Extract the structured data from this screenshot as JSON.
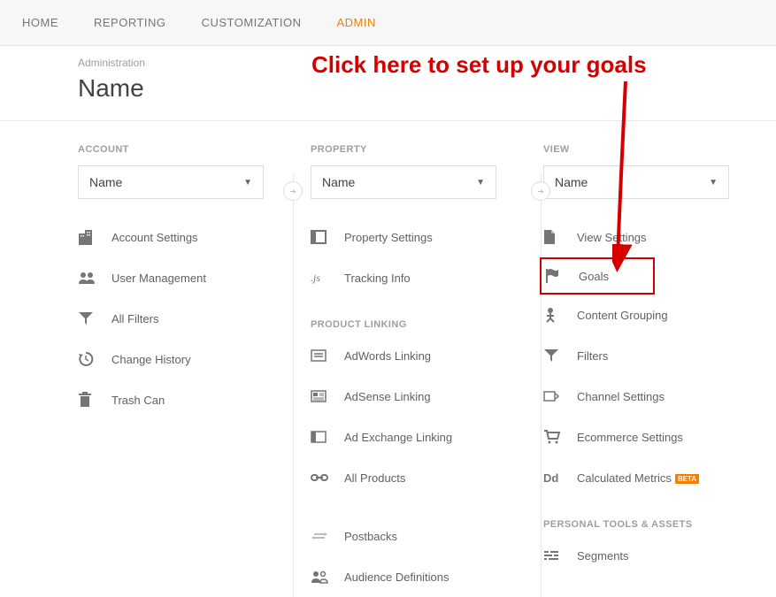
{
  "topnav": {
    "home": "HOME",
    "reporting": "REPORTING",
    "customization": "CUSTOMIZATION",
    "admin": "ADMIN"
  },
  "header": {
    "label": "Administration",
    "title": "Name"
  },
  "callout": "Click here to set up your goals",
  "columns": {
    "account": {
      "label": "ACCOUNT",
      "selected": "Name",
      "items": [
        {
          "id": "account-settings",
          "label": "Account Settings"
        },
        {
          "id": "user-management",
          "label": "User Management"
        },
        {
          "id": "all-filters",
          "label": "All Filters"
        },
        {
          "id": "change-history",
          "label": "Change History"
        },
        {
          "id": "trash-can",
          "label": "Trash Can"
        }
      ]
    },
    "property": {
      "label": "PROPERTY",
      "selected": "Name",
      "items": [
        {
          "id": "property-settings",
          "label": "Property Settings"
        },
        {
          "id": "tracking-info",
          "label": "Tracking Info"
        }
      ],
      "product_linking_label": "PRODUCT LINKING",
      "product_linking": [
        {
          "id": "adwords-linking",
          "label": "AdWords Linking"
        },
        {
          "id": "adsense-linking",
          "label": "AdSense Linking"
        },
        {
          "id": "ad-exchange-linking",
          "label": "Ad Exchange Linking"
        },
        {
          "id": "all-products",
          "label": "All Products"
        }
      ],
      "bottom": [
        {
          "id": "postbacks",
          "label": "Postbacks"
        },
        {
          "id": "audience-definitions",
          "label": "Audience Definitions"
        }
      ]
    },
    "view": {
      "label": "VIEW",
      "selected": "Name",
      "items": [
        {
          "id": "view-settings",
          "label": "View Settings"
        },
        {
          "id": "goals",
          "label": "Goals"
        },
        {
          "id": "content-grouping",
          "label": "Content Grouping"
        },
        {
          "id": "filters",
          "label": "Filters"
        },
        {
          "id": "channel-settings",
          "label": "Channel Settings"
        },
        {
          "id": "ecommerce-settings",
          "label": "Ecommerce Settings"
        },
        {
          "id": "calculated-metrics",
          "label": "Calculated Metrics"
        }
      ],
      "beta": "BETA",
      "personal_label": "PERSONAL TOOLS & ASSETS",
      "personal": [
        {
          "id": "segments",
          "label": "Segments"
        }
      ]
    }
  }
}
